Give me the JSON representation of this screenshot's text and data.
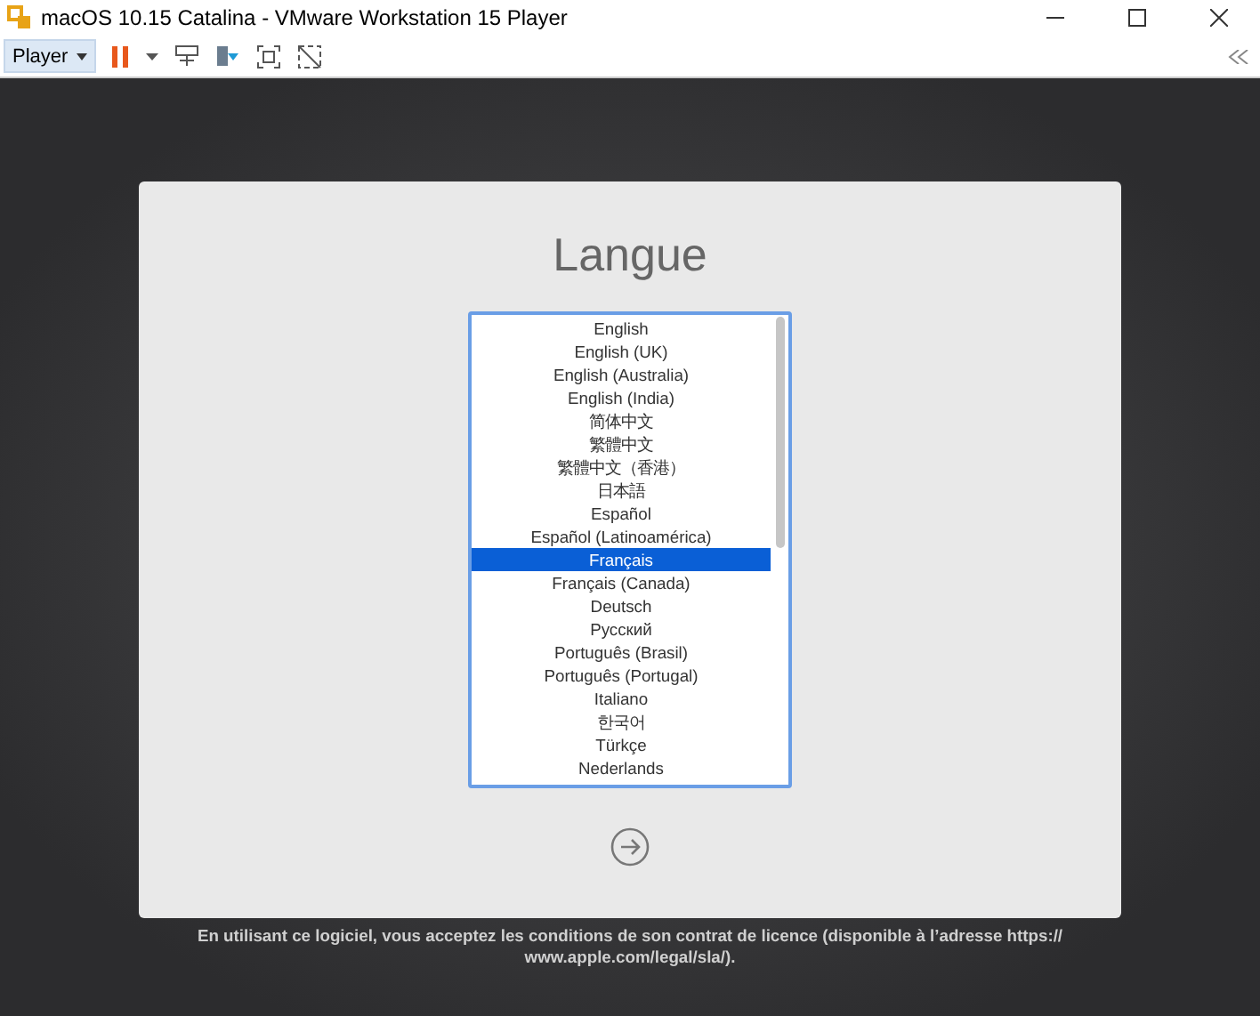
{
  "window": {
    "title": "macOS 10.15 Catalina - VMware Workstation 15 Player"
  },
  "toolbar": {
    "player_menu": "Player"
  },
  "installer": {
    "title": "Langue",
    "languages": [
      {
        "label": "English",
        "selected": false
      },
      {
        "label": "English (UK)",
        "selected": false
      },
      {
        "label": "English (Australia)",
        "selected": false
      },
      {
        "label": "English (India)",
        "selected": false
      },
      {
        "label": "简体中文",
        "selected": false
      },
      {
        "label": "繁體中文",
        "selected": false
      },
      {
        "label": "繁體中文（香港）",
        "selected": false
      },
      {
        "label": "日本語",
        "selected": false
      },
      {
        "label": "Español",
        "selected": false
      },
      {
        "label": "Español (Latinoamérica)",
        "selected": false
      },
      {
        "label": "Français",
        "selected": true
      },
      {
        "label": "Français (Canada)",
        "selected": false
      },
      {
        "label": "Deutsch",
        "selected": false
      },
      {
        "label": "Русский",
        "selected": false
      },
      {
        "label": "Português (Brasil)",
        "selected": false
      },
      {
        "label": "Português (Portugal)",
        "selected": false
      },
      {
        "label": "Italiano",
        "selected": false
      },
      {
        "label": "한국어",
        "selected": false
      },
      {
        "label": "Türkçe",
        "selected": false
      },
      {
        "label": "Nederlands",
        "selected": false
      }
    ]
  },
  "license_notice": "En utilisant ce logiciel, vous acceptez les conditions de son contrat de licence (disponible à l’adresse https:// www.apple.com/legal/sla/)."
}
